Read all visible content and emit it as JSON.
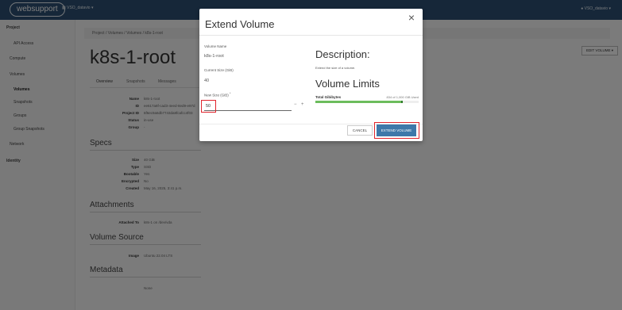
{
  "topbar": {
    "logo": "websupport",
    "project_switcher": "VSO_datavio",
    "user_menu": "VSO_datavio"
  },
  "sidebar": {
    "project": "Project",
    "api_access": "API Access",
    "compute": "Compute",
    "volumes_group": "Volumes",
    "volumes": "Volumes",
    "snapshots": "Snapshots",
    "groups": "Groups",
    "group_snapshots": "Group Snapshots",
    "network": "Network",
    "identity": "Identity"
  },
  "breadcrumb": "Project / Volumes / Volumes / k8s-1-root",
  "page": {
    "title": "k8s-1-root",
    "edit_button": "EDIT VOLUME",
    "tabs": [
      "Overview",
      "Snapshots",
      "Messages"
    ]
  },
  "overview": {
    "rows": [
      {
        "k": "Name",
        "v": "k8s-1-root"
      },
      {
        "k": "ID",
        "v": "ee617a8f-cad3-4eed-8ed9-e97d"
      },
      {
        "k": "Project ID",
        "v": "6f6ec9a6db7743da8fcafcc4f03"
      },
      {
        "k": "Status",
        "v": "in-use"
      },
      {
        "k": "Group",
        "v": "-"
      }
    ],
    "specs_title": "Specs",
    "specs": [
      {
        "k": "Size",
        "v": "40 GiB"
      },
      {
        "k": "Type",
        "v": "SSD"
      },
      {
        "k": "Bootable",
        "v": "Yes"
      },
      {
        "k": "Encrypted",
        "v": "No"
      },
      {
        "k": "Created",
        "v": "May 16, 2025, 3:41 p.m."
      }
    ],
    "attachments_title": "Attachments",
    "attached_to": {
      "k": "Attached To",
      "v": "k8s-1 on /dev/vda"
    },
    "volume_source_title": "Volume Source",
    "image": {
      "k": "Image",
      "v": "Ubuntu 22.04 LTS"
    },
    "metadata_title": "Metadata",
    "metadata_value": "None"
  },
  "modal": {
    "title": "Extend Volume",
    "volume_name_label": "Volume Name",
    "volume_name": "k8s-1-root",
    "current_size_label": "Current Size (GiB)",
    "current_size": "40",
    "new_size_label": "New Size (GiB)",
    "new_size_required": "*",
    "new_size_value": "50",
    "description_title": "Description:",
    "description_text": "Extend the size of a volume.",
    "limits_title": "Volume Limits",
    "quota_label": "Total Gibibytes",
    "quota_value": "834 of 1,000 GiB Used",
    "quota_used_fraction": 0.834,
    "quota_new_fraction": 0.01,
    "cancel": "CANCEL",
    "extend": "EXTEND VOLUME",
    "highlight_color": "#e0242c"
  }
}
